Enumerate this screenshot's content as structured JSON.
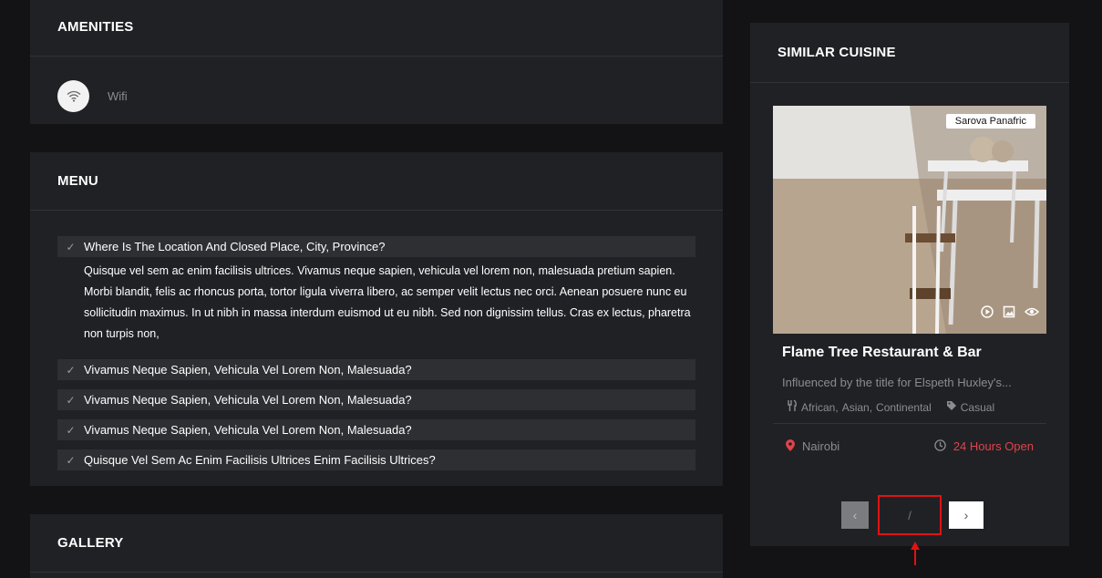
{
  "amenities": {
    "title": "AMENITIES",
    "items": [
      {
        "icon": "wifi-icon",
        "label": "Wifi"
      }
    ]
  },
  "menu": {
    "title": "MENU",
    "items": [
      {
        "q": "Where Is The Location And Closed Place, City, Province?",
        "a": "Quisque vel sem ac enim facilisis ultrices. Vivamus neque sapien, vehicula vel lorem non, malesuada pretium sapien. Morbi blandit, felis ac rhoncus porta, tortor ligula viverra libero, ac semper velit lectus nec orci. Aenean posuere nunc eu sollicitudin maximus. In ut nibh in massa interdum euismod ut eu nibh. Sed non dignissim tellus. Cras ex lectus, pharetra non turpis non,"
      },
      {
        "q": "Vivamus Neque Sapien, Vehicula Vel Lorem Non, Malesuada?"
      },
      {
        "q": "Vivamus Neque Sapien, Vehicula Vel Lorem Non, Malesuada?"
      },
      {
        "q": "Vivamus Neque Sapien, Vehicula Vel Lorem Non, Malesuada?"
      },
      {
        "q": "Quisque Vel Sem Ac Enim Facilisis Ultrices Enim Facilisis Ultrices?"
      }
    ]
  },
  "gallery": {
    "title": "GALLERY"
  },
  "similar": {
    "title": "SIMILAR CUISINE",
    "card": {
      "badge": "Sarova Panafric",
      "title": "Flame Tree Restaurant & Bar",
      "description": "Influenced by the title for Elspeth Huxley's...",
      "categories": [
        "African,",
        "Asian,",
        "Continental"
      ],
      "tag": "Casual",
      "location": "Nairobi",
      "hours": "24 Hours Open",
      "accent": "#e0434b"
    },
    "pager": {
      "prev": "‹",
      "counter": "/",
      "next": "›"
    }
  }
}
